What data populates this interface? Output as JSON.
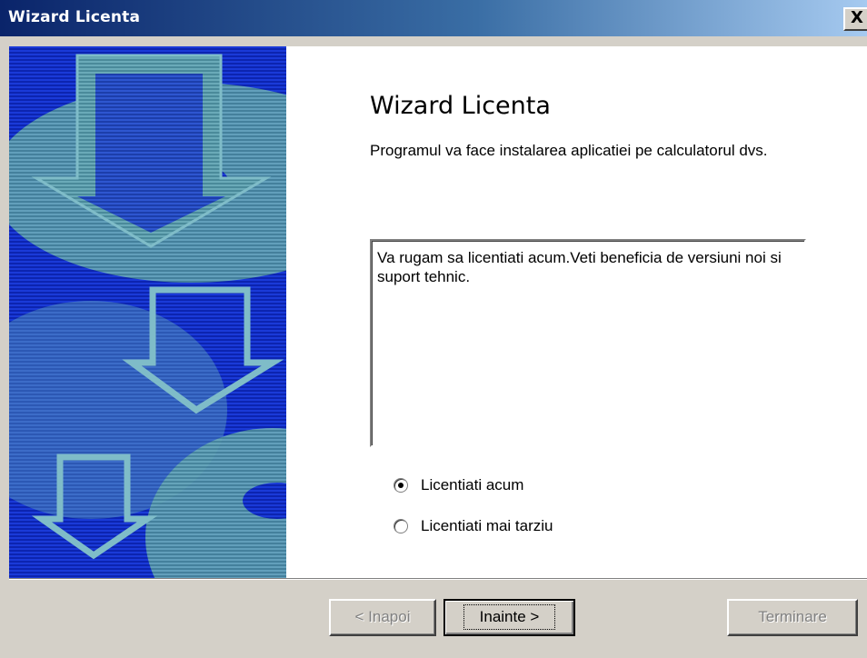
{
  "window": {
    "title": "Wizard Licenta",
    "close_label": "X"
  },
  "wizard": {
    "heading": "Wizard Licenta",
    "intro": "Programul va face instalarea aplicatiei pe calculatorul dvs.",
    "message": "Va rugam sa licentiati acum.Veti beneficia de versiuni noi si suport tehnic."
  },
  "options": [
    {
      "label": "Licentiati acum",
      "checked": true
    },
    {
      "label": "Licentiati mai tarziu",
      "checked": false
    }
  ],
  "buttons": {
    "back": "< Inapoi",
    "next": "Inainte >",
    "finish": "Terminare"
  },
  "colors": {
    "title_gradient_start": "#0a246a",
    "side_art_blue": "#1030c8",
    "side_art_shape": "#5a9aa8",
    "dialog_face": "#d4d0c8"
  },
  "icons": {
    "side_art": "down-arrows-illustration"
  }
}
